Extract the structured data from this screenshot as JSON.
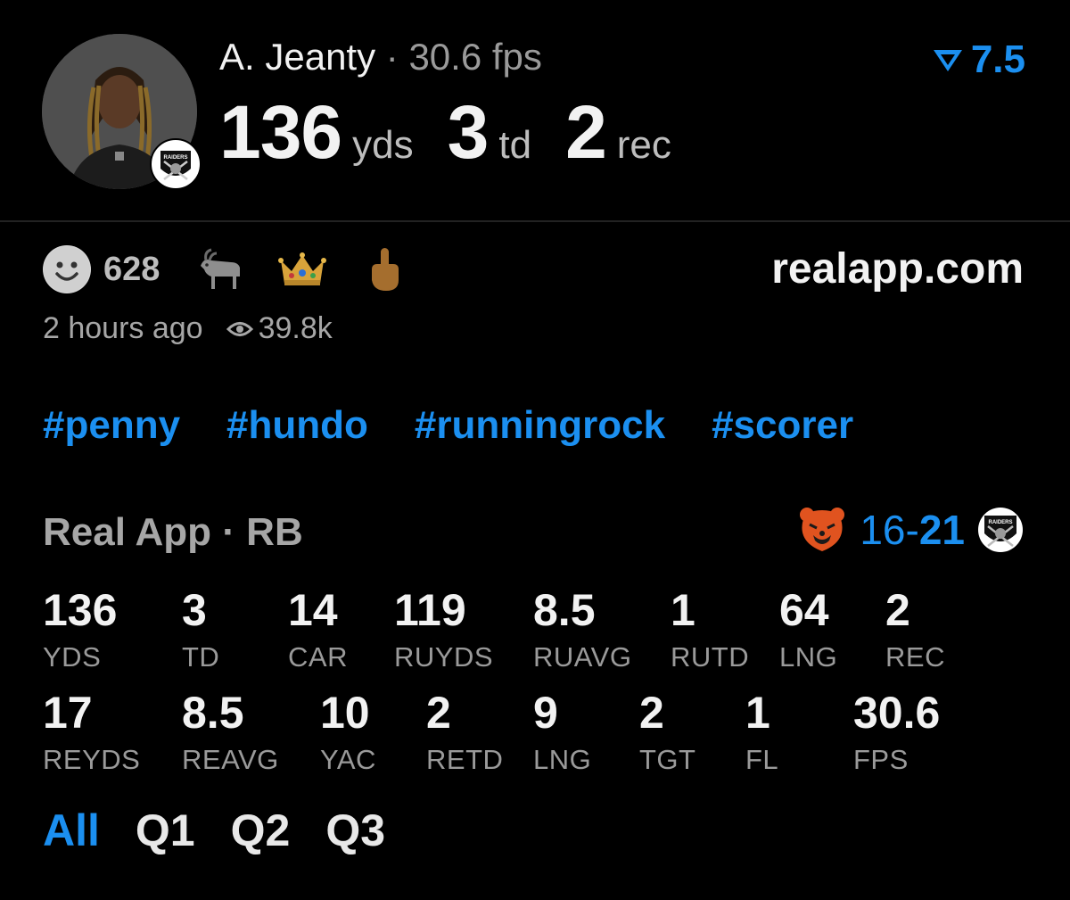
{
  "player": {
    "name": "A. Jeanty",
    "separator": "·",
    "fps_text": "30.6 fps",
    "headline": [
      {
        "value": "136",
        "unit": "yds"
      },
      {
        "value": "3",
        "unit": "td"
      },
      {
        "value": "2",
        "unit": "rec"
      }
    ],
    "team_logo_text": "RAIDERS"
  },
  "boost": {
    "icon": "boost-arrow-icon",
    "value": "7.5",
    "color": "#1b8ff0"
  },
  "reactions": {
    "count": "628",
    "items": [
      "smiley-face-icon",
      "goat-emoji",
      "crown-emoji",
      "middle-finger-emoji"
    ]
  },
  "site": "realapp.com",
  "meta": {
    "time_ago": "2 hours ago",
    "views": "39.8k"
  },
  "tags": [
    "#penny",
    "#hundo",
    "#runningrock",
    "#scorer"
  ],
  "game": {
    "league": "Real App · RB",
    "score_home": "16",
    "score_dash": "-",
    "score_away": "21",
    "home_logo": "bears-logo",
    "away_logo": "raiders-logo",
    "away_logo_text": "RAIDERS"
  },
  "stats": [
    {
      "value": "136",
      "label": "YDS"
    },
    {
      "value": "3",
      "label": "TD"
    },
    {
      "value": "14",
      "label": "CAR"
    },
    {
      "value": "119",
      "label": "RUYDS"
    },
    {
      "value": "8.5",
      "label": "RUAVG"
    },
    {
      "value": "1",
      "label": "RUTD"
    },
    {
      "value": "64",
      "label": "LNG"
    },
    {
      "value": "2",
      "label": "REC"
    },
    {
      "value": "17",
      "label": "REYDS"
    },
    {
      "value": "8.5",
      "label": "REAVG"
    },
    {
      "value": "10",
      "label": "YAC"
    },
    {
      "value": "2",
      "label": "RETD"
    },
    {
      "value": "9",
      "label": "LNG"
    },
    {
      "value": "2",
      "label": "TGT"
    },
    {
      "value": "1",
      "label": "FL"
    },
    {
      "value": "30.6",
      "label": "FPS"
    }
  ],
  "periods": {
    "items": [
      "All",
      "Q1",
      "Q2",
      "Q3"
    ],
    "active": "All"
  }
}
